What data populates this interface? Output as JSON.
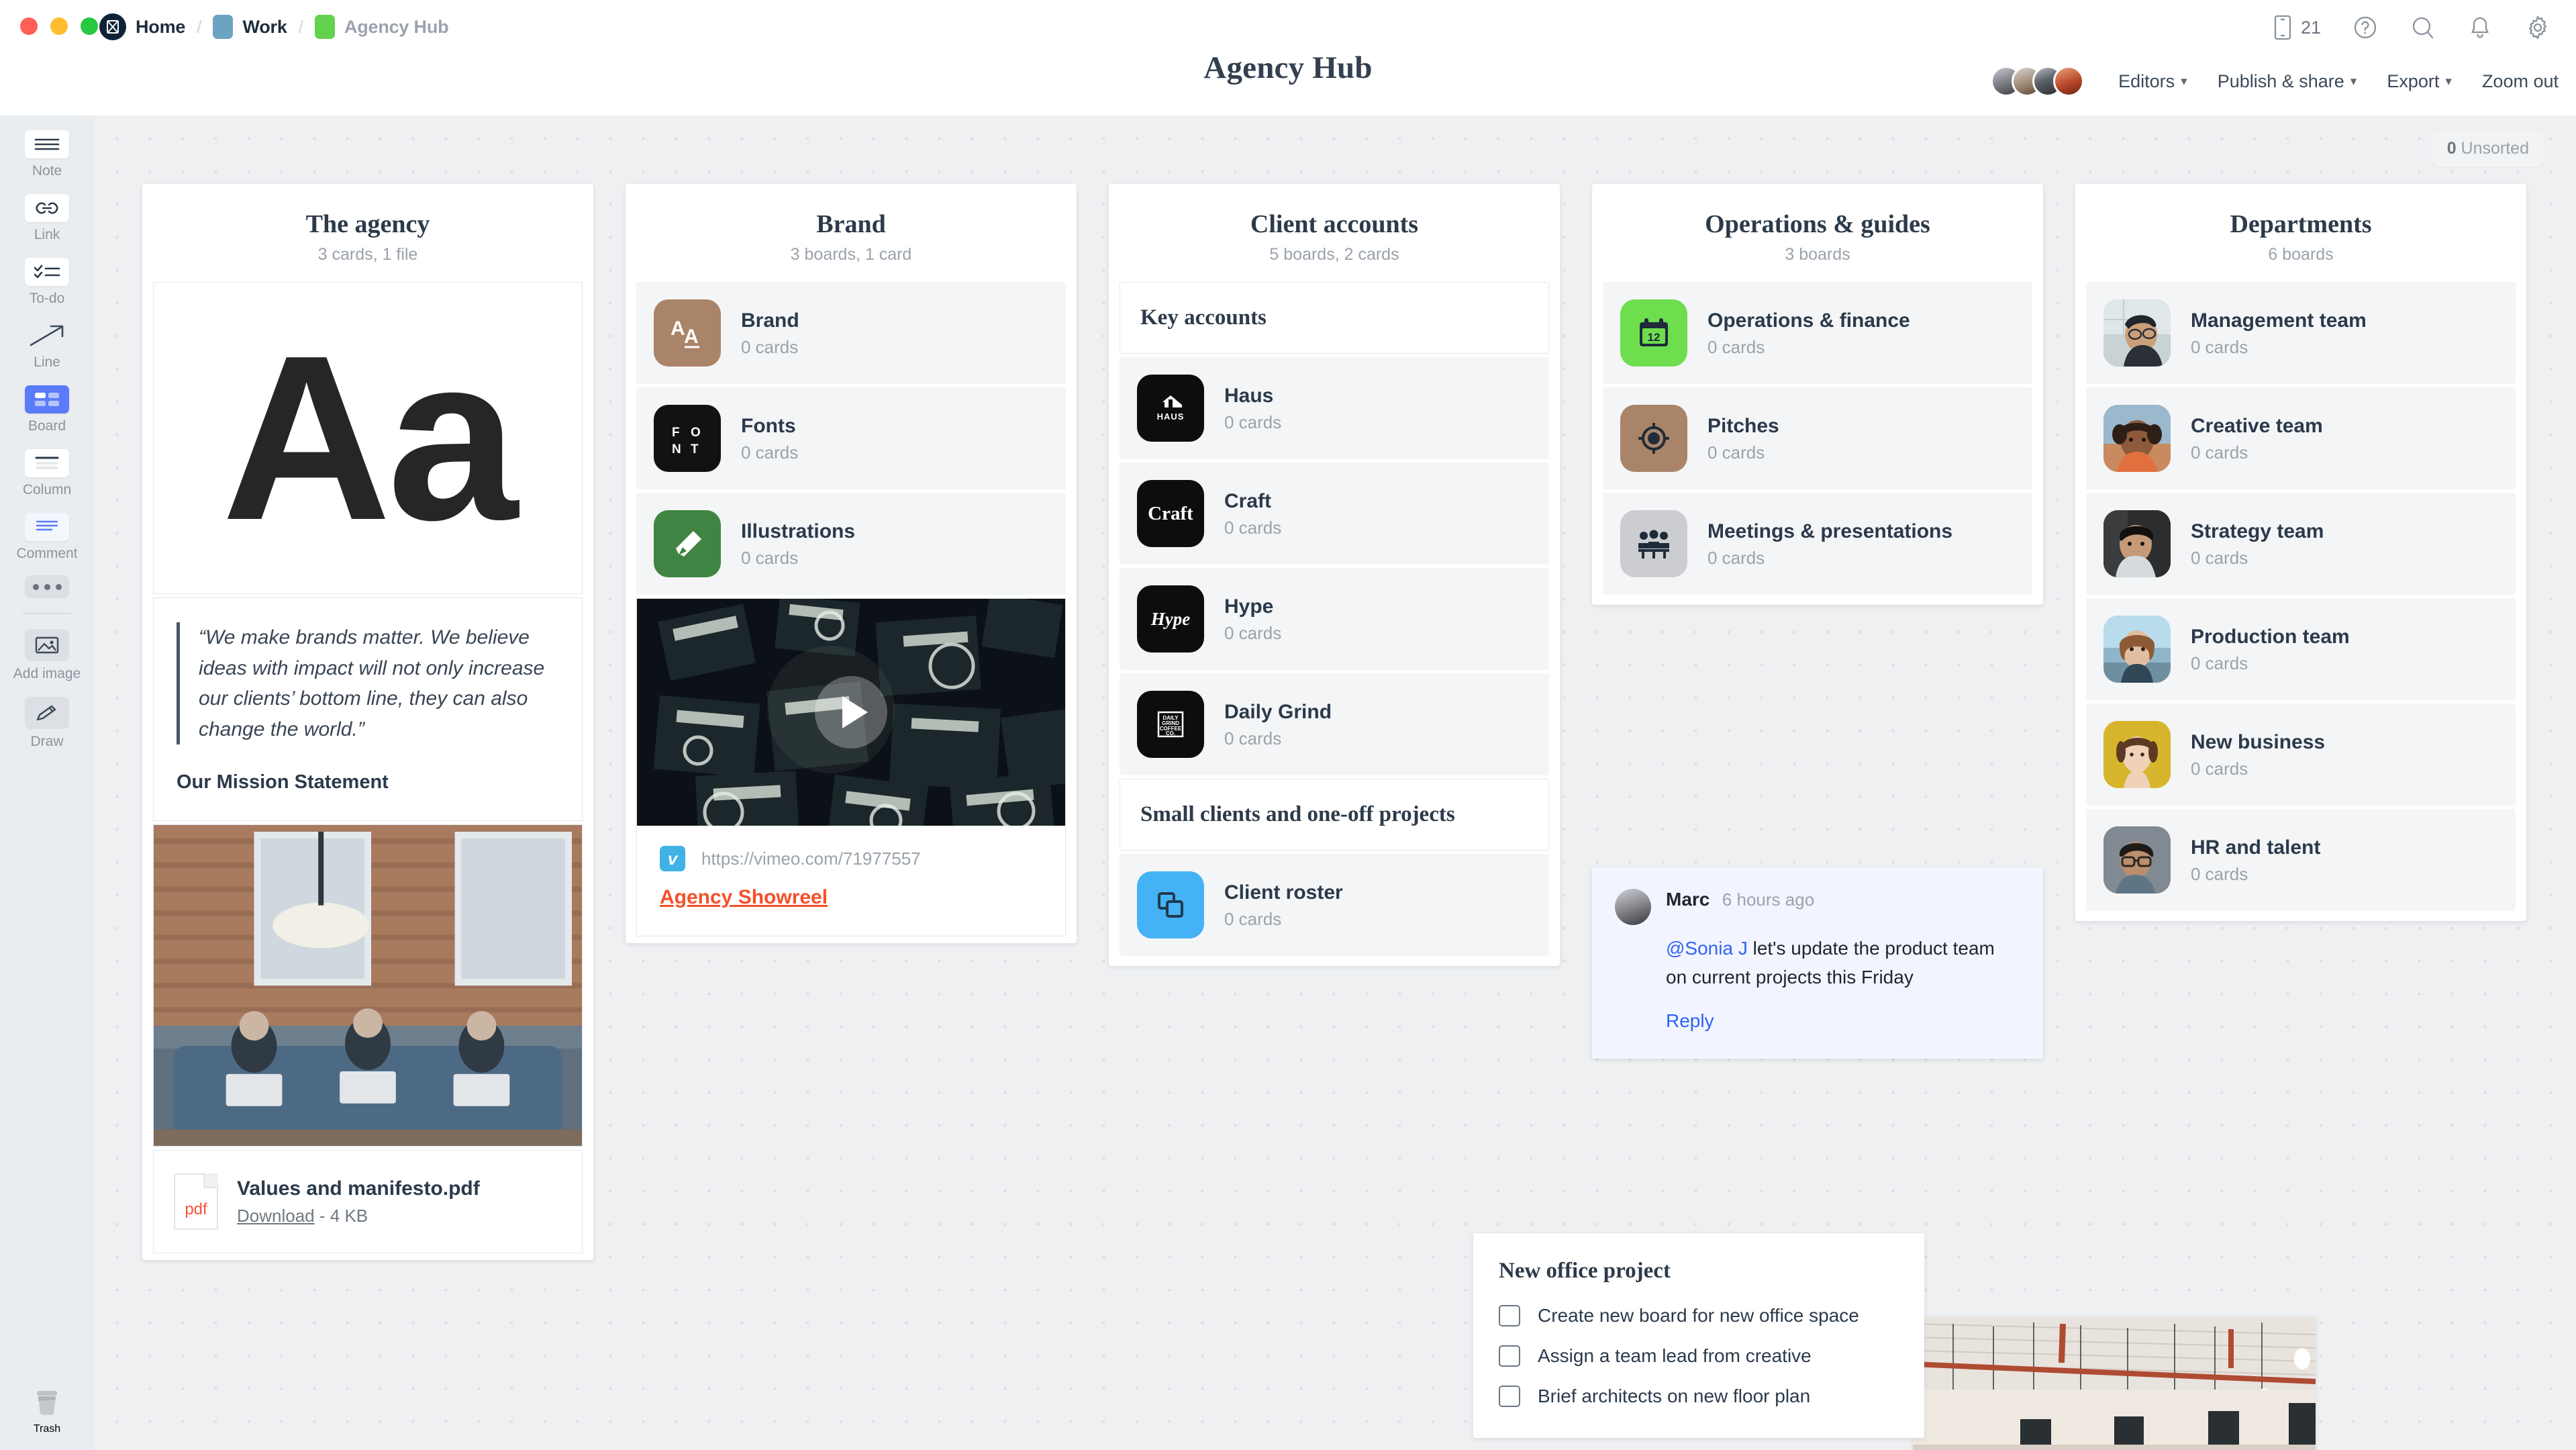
{
  "window": {
    "traffic_lights": [
      "close",
      "minimize",
      "maximize"
    ]
  },
  "breadcrumb": {
    "items": [
      {
        "label": "Home",
        "icon": "milanote-logo-icon",
        "color": "#0f2337"
      },
      {
        "label": "Work",
        "icon": "board-square-icon",
        "color": "#6ca3c0"
      },
      {
        "label": "Agency Hub",
        "icon": "board-square-icon",
        "color": "#62d14d"
      }
    ],
    "separator": "/"
  },
  "header": {
    "title": "Agency Hub",
    "mobile_count": "21",
    "icons": [
      "mobile-icon",
      "help-icon",
      "search-icon",
      "notifications-icon",
      "settings-icon"
    ],
    "actions": [
      {
        "label": "Editors",
        "caret": true
      },
      {
        "label": "Publish & share",
        "caret": true
      },
      {
        "label": "Export",
        "caret": true
      },
      {
        "label": "Zoom out",
        "caret": false
      }
    ]
  },
  "toolbar": {
    "items": [
      {
        "label": "Note",
        "icon": "note-icon"
      },
      {
        "label": "Link",
        "icon": "link-icon"
      },
      {
        "label": "To-do",
        "icon": "todo-icon"
      },
      {
        "label": "Line",
        "icon": "line-arrow-icon"
      },
      {
        "label": "Board",
        "icon": "board-icon",
        "active": true
      },
      {
        "label": "Column",
        "icon": "column-icon"
      },
      {
        "label": "Comment",
        "icon": "comment-icon"
      }
    ],
    "more_label": "more-options",
    "extras": [
      {
        "label": "Add image",
        "icon": "add-image-icon"
      },
      {
        "label": "Draw",
        "icon": "pencil-draw-icon"
      }
    ],
    "trash": {
      "label": "Trash",
      "icon": "trash-icon"
    }
  },
  "canvas": {
    "unsorted_count": "0",
    "unsorted_label": "Unsorted"
  },
  "columns": [
    {
      "title": "The agency",
      "subtitle": "3 cards, 1 file",
      "typography_card": {
        "text": "Aa"
      },
      "quote_card": {
        "quote": "“We make brands matter. We believe ideas with impact will not only increase our clients’ bottom line, they can also change the world.”",
        "caption": "Our Mission Statement"
      },
      "photo_card": {
        "alt": "office-team-photo"
      },
      "file_card": {
        "name": "Values and manifesto.pdf",
        "download_label": "Download",
        "size": "- 4 KB",
        "type": "pdf"
      }
    },
    {
      "title": "Brand",
      "subtitle": "3 boards, 1 card",
      "boards": [
        {
          "name": "Brand",
          "cards": "0 cards",
          "icon": "aa-typography-icon",
          "color": "#a98468"
        },
        {
          "name": "Fonts",
          "cards": "0 cards",
          "icon": "font-grid-icon",
          "color": "#111214"
        },
        {
          "name": "Illustrations",
          "cards": "0 cards",
          "icon": "pen-nib-icon",
          "color": "#3f8442"
        }
      ],
      "video_card": {
        "url": "https://vimeo.com/71977557",
        "title": "Agency Showreel",
        "provider": "vimeo",
        "provider_glyph": "v"
      }
    },
    {
      "title": "Client accounts",
      "subtitle": "5 boards, 2 cards",
      "sections": [
        {
          "type": "note",
          "text": "Key accounts"
        },
        {
          "type": "board",
          "name": "Haus",
          "cards": "0 cards",
          "icon": "haus-logo-icon",
          "color": "#0d0d0d",
          "logo_text": "HAUS"
        },
        {
          "type": "board",
          "name": "Craft",
          "cards": "0 cards",
          "icon": "craft-logo-icon",
          "color": "#0d0d0d",
          "logo_text": "Craft"
        },
        {
          "type": "board",
          "name": "Hype",
          "cards": "0 cards",
          "icon": "hype-logo-icon",
          "color": "#0d0d0d",
          "logo_text": "Hype"
        },
        {
          "type": "board",
          "name": "Daily Grind",
          "cards": "0 cards",
          "icon": "daily-grind-logo-icon",
          "color": "#0d0d0d",
          "logo_text": "DAILY GRIND COFFEE CO."
        },
        {
          "type": "note",
          "text": "Small clients and one-off projects"
        },
        {
          "type": "board",
          "name": "Client roster",
          "cards": "0 cards",
          "icon": "copy-boards-icon",
          "color": "#45b2f5"
        }
      ]
    },
    {
      "title": "Operations & guides",
      "subtitle": "3 boards",
      "boards": [
        {
          "name": "Operations & finance",
          "cards": "0 cards",
          "icon": "calendar-12-icon",
          "color": "#6ede4f"
        },
        {
          "name": "Pitches",
          "cards": "0 cards",
          "icon": "target-icon",
          "color": "#a98468"
        },
        {
          "name": "Meetings & presentations",
          "cards": "0 cards",
          "icon": "meeting-people-icon",
          "color": "#cbcdd1"
        }
      ],
      "comment": {
        "author": "Marc",
        "time": "6 hours ago",
        "mention": "@Sonia J",
        "body": " let's update the product team on current projects this Friday",
        "reply_label": "Reply"
      }
    },
    {
      "title": "Departments",
      "subtitle": "6 boards",
      "boards": [
        {
          "name": "Management team",
          "cards": "0 cards",
          "icon": "avatar-photo-icon",
          "color": "#6d7f86"
        },
        {
          "name": "Creative team",
          "cards": "0 cards",
          "icon": "avatar-photo-icon",
          "color": "#d98258"
        },
        {
          "name": "Strategy team",
          "cards": "0 cards",
          "icon": "avatar-photo-icon",
          "color": "#2d2f31"
        },
        {
          "name": "Production team",
          "cards": "0 cards",
          "icon": "avatar-photo-icon",
          "color": "#9dbcd0"
        },
        {
          "name": "New business",
          "cards": "0 cards",
          "icon": "avatar-photo-icon",
          "color": "#d6b52c"
        },
        {
          "name": "HR and talent",
          "cards": "0 cards",
          "icon": "avatar-photo-icon",
          "color": "#7b838b"
        }
      ]
    }
  ],
  "todo_card": {
    "title": "New office project",
    "items": [
      {
        "text": "Create new board for new office space",
        "checked": false
      },
      {
        "text": "Assign a team lead from creative",
        "checked": false
      },
      {
        "text": "Brief architects on new floor plan",
        "checked": false
      }
    ]
  },
  "bottom_photo": {
    "alt": "loft-interior-photo"
  }
}
